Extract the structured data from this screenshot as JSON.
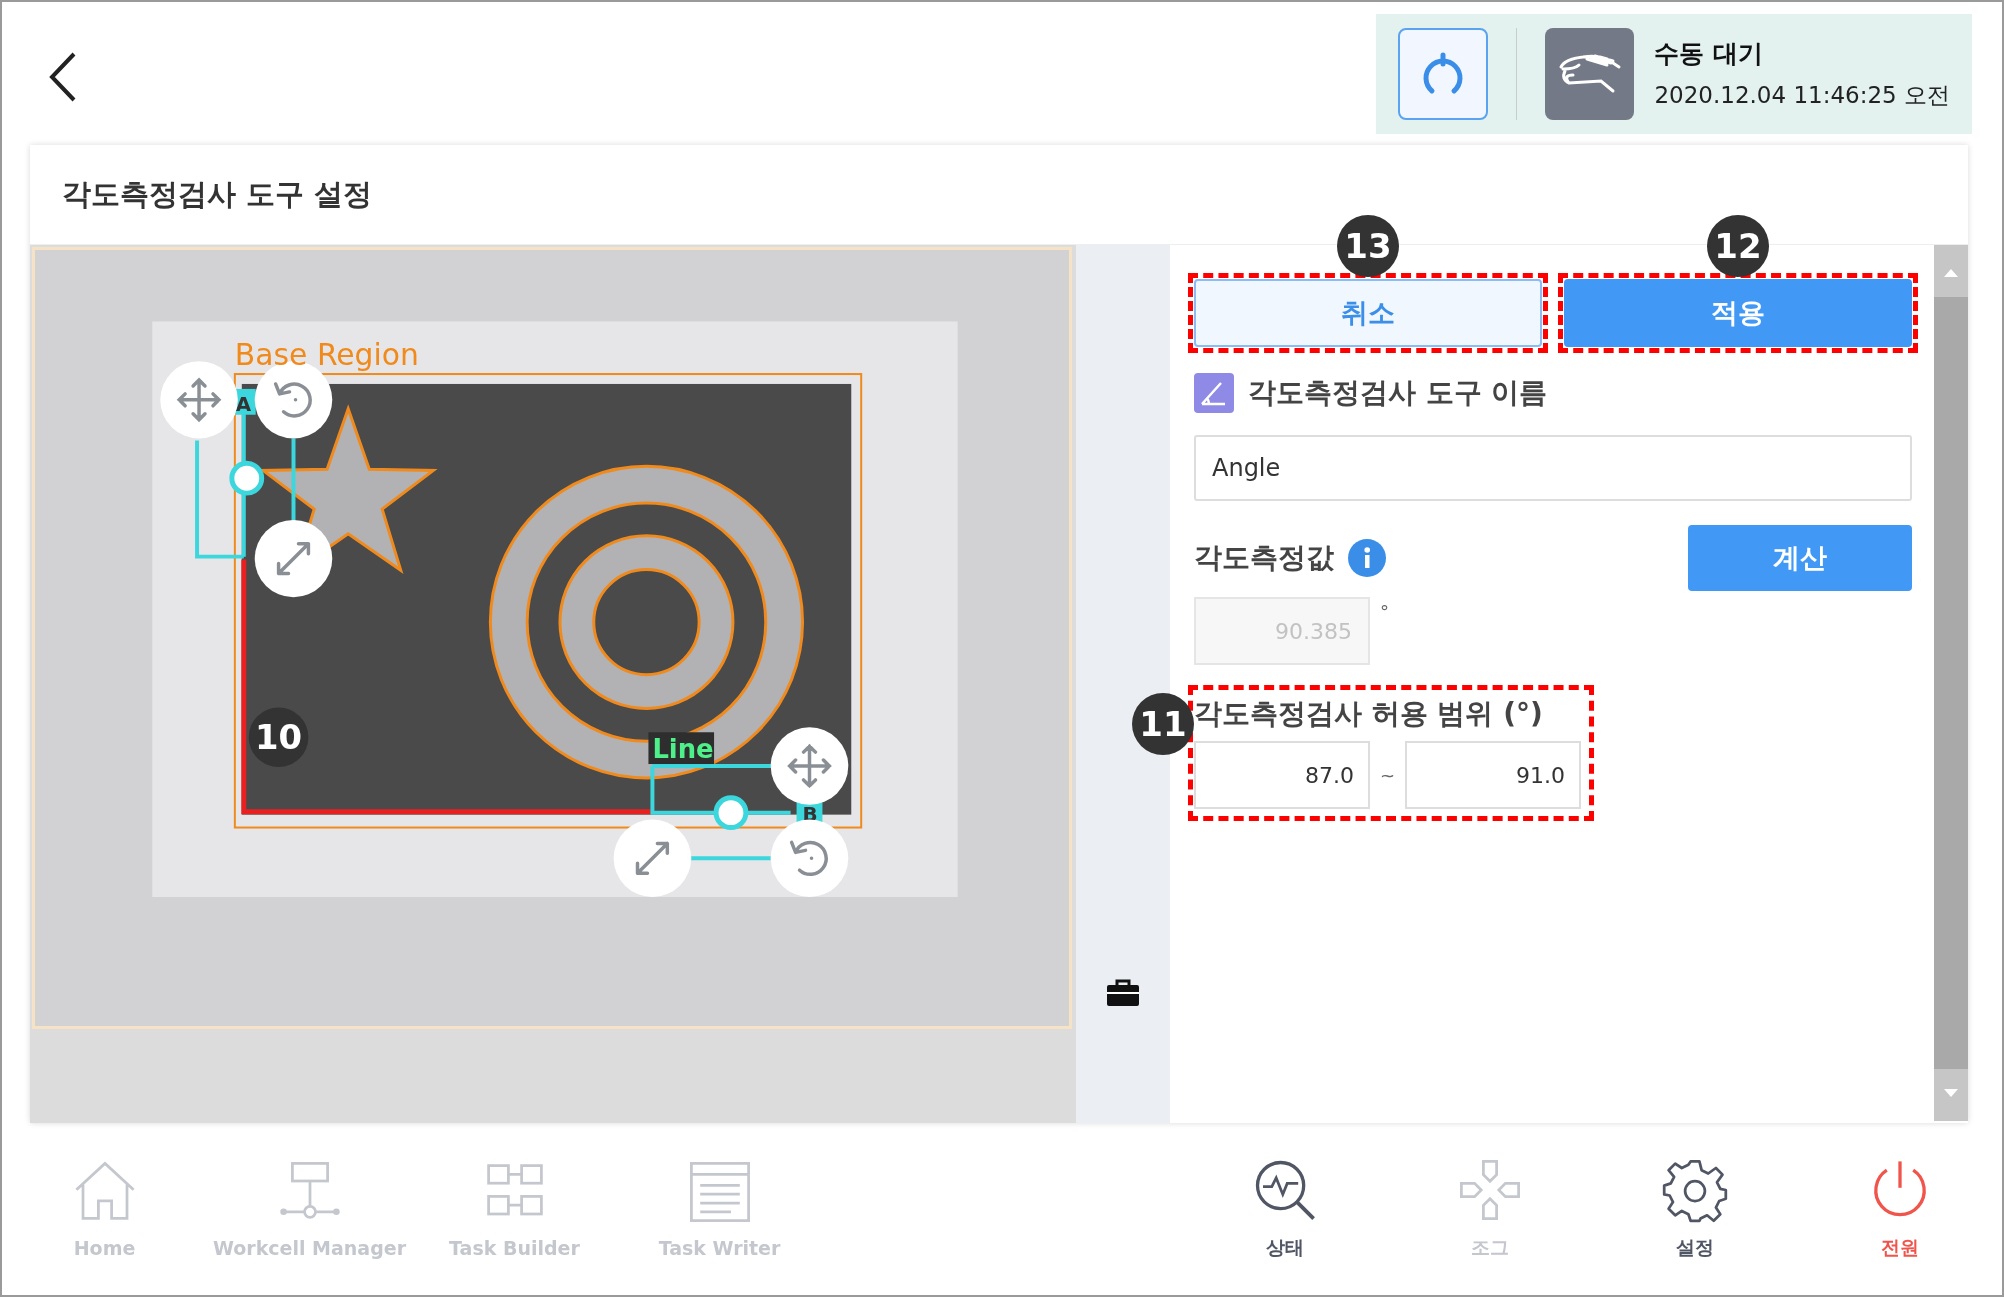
{
  "header": {
    "status": {
      "mode": "수동 대기",
      "timestamp": "2020.12.04 11:46:25 오전"
    }
  },
  "panel": {
    "title": "각도측정검사 도구 설정"
  },
  "image": {
    "region_label": "Base Region",
    "line_label": "Line",
    "point_a": "A",
    "point_b": "B",
    "callout": "10"
  },
  "actions": [
    {
      "label": "취소",
      "kind": "secondary",
      "callout": "13"
    },
    {
      "label": "적용",
      "kind": "primary",
      "callout": "12"
    }
  ],
  "tool_name": {
    "label": "각도측정검사 도구 이름",
    "value": "Angle"
  },
  "measure": {
    "label": "각도측정값",
    "button": "계산",
    "value": "90.385",
    "unit": "°"
  },
  "range": {
    "label": "각도측정검사 허용 범위 (°)",
    "min": "87.0",
    "separator": "~",
    "max": "91.0",
    "callout": "11"
  },
  "nav": [
    {
      "label": "Home",
      "disabled": true,
      "kind": "normal"
    },
    {
      "label": "Workcell Manager",
      "disabled": true,
      "kind": "normal"
    },
    {
      "label": "Task Builder",
      "disabled": true,
      "kind": "normal"
    },
    {
      "label": "Task Writer",
      "disabled": true,
      "kind": "normal"
    },
    {
      "label": "상태",
      "disabled": false,
      "kind": "normal"
    },
    {
      "label": "조그",
      "disabled": true,
      "kind": "normal"
    },
    {
      "label": "설정",
      "disabled": false,
      "kind": "normal"
    },
    {
      "label": "전원",
      "disabled": false,
      "kind": "power"
    }
  ]
}
